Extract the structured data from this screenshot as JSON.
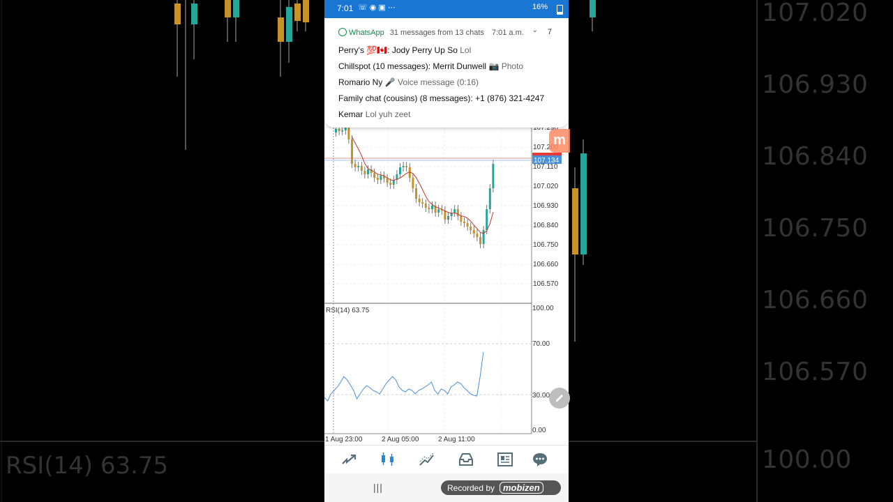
{
  "status_bar": {
    "time": "7:01",
    "battery": "16%"
  },
  "notification": {
    "app": "WhatsApp",
    "summary": "31 messages from 13 chats",
    "time": "7:01 a.m.",
    "count": "7",
    "messages": [
      {
        "sender": "Perry's 💯🇨🇦:",
        "text": "Jody Perry Up So",
        "body": "Lol"
      },
      {
        "sender": "Chillspot (10 messages):",
        "text": "Merrit Dunwell",
        "body": "📷 Photo"
      },
      {
        "sender": "Romario Ny",
        "text": "",
        "body": "🎤 Voice message (0:16)"
      },
      {
        "sender": "Family chat  (cousins) (8 messages):",
        "text": "+1 (876) 321-4247",
        "body": ""
      },
      {
        "sender": "Kemar",
        "text": "",
        "body": "Lol yuh zeet"
      }
    ]
  },
  "chart": {
    "price_axis": [
      "107.290",
      "107.200",
      "107.110",
      "107.020",
      "106.930",
      "106.840",
      "106.750",
      "106.660",
      "106.570"
    ],
    "current_price": "107.134",
    "indicator": "RSI(14) 63.75",
    "rsi_axis": [
      "100.00",
      "70.00",
      "30.00",
      "0.00"
    ],
    "time_axis": [
      "1 Aug 23:00",
      "2 Aug 05:00",
      "2 Aug 11:00"
    ],
    "colors": {
      "bull": "#26a69a",
      "bear": "#c8922a",
      "ma": "#c0392b",
      "rsi": "#4a90d9",
      "price_tag": "#4a90d9"
    }
  },
  "background": {
    "price_labels": [
      "107.020",
      "106.930",
      "106.840",
      "106.750",
      "106.660",
      "106.570",
      "100.00"
    ],
    "rsi_label": "RSI(14) 63.75"
  },
  "nav_icons": [
    "quotes-icon",
    "chart-icon",
    "trade-icon",
    "history-icon",
    "news-icon",
    "messages-icon"
  ],
  "recorder": {
    "label": "Recorded by",
    "brand": "mobizen"
  }
}
